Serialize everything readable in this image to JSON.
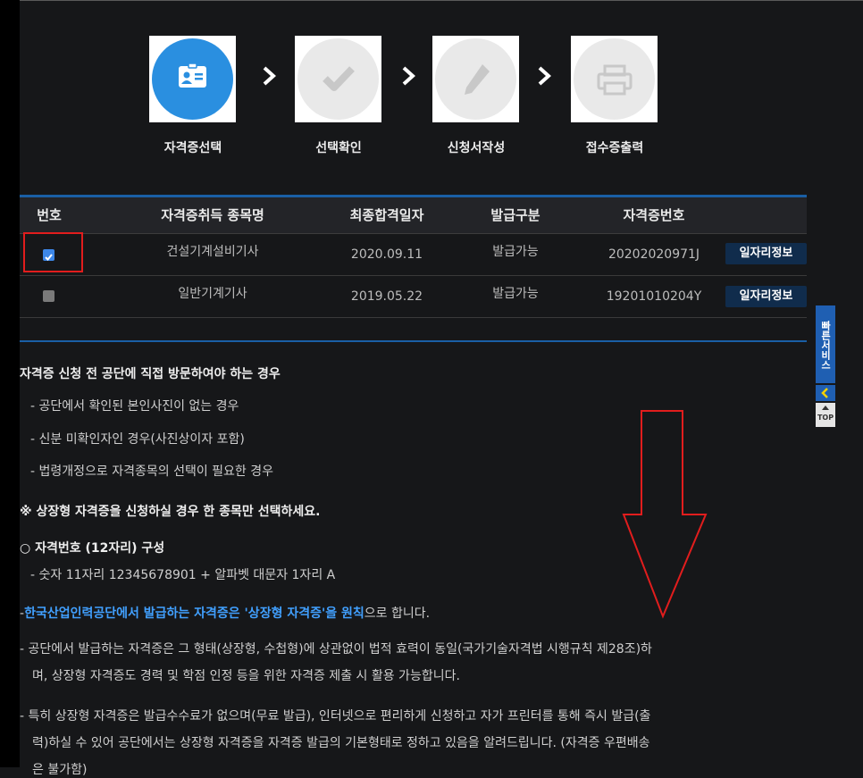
{
  "steps": [
    {
      "label": "자격증선택",
      "icon": "id-card-icon",
      "active": true
    },
    {
      "label": "선택확인",
      "icon": "checkmark-icon",
      "active": false
    },
    {
      "label": "신청서작성",
      "icon": "pencil-icon",
      "active": false
    },
    {
      "label": "접수증출력",
      "icon": "printer-icon",
      "active": false
    }
  ],
  "table": {
    "headers": [
      "번호",
      "자격증취득 종목명",
      "최종합격일자",
      "발급구분",
      "자격증번호"
    ],
    "rows": [
      {
        "checked": true,
        "name": "건설기계설비기사",
        "date": "2020.09.11",
        "status": "발급가능",
        "number": "20202020971J",
        "button": "일자리정보"
      },
      {
        "checked": false,
        "name": "일반기계기사",
        "date": "2019.05.22",
        "status": "발급가능",
        "number": "19201010204Y",
        "button": "일자리정보"
      }
    ]
  },
  "quick_service": {
    "label": "빠른서비스",
    "top": "TOP"
  },
  "notice": {
    "heading": "자격증 신청 전 공단에 직접 방문하여야 하는 경우",
    "items": [
      "- 공단에서 확인된 본인사진이 없는 경우",
      "- 신분 미확인자인 경우(사진상이자 포함)",
      "- 법령개정으로 자격종목의 선택이 필요한 경우"
    ],
    "warning": "※ 상장형 자격증을 신청하실 경우 한 종목만 선택하세요.",
    "cert_title": "○ 자격번호 (12자리) 구성",
    "cert_detail": "- 숫자 11자리 12345678901 + 알파벳 대문자 1자리 A",
    "principle_prefix": "-",
    "principle_highlight": "한국산업인력공단에서 발급하는 자격증은 '상장형 자격증'을 원칙",
    "principle_suffix": "으로 합니다.",
    "para1_line1": "- 공단에서 발급하는 자격증은 그 형태(상장형, 수첩형)에 상관없이 법적 효력이 동일(국가기술자격법 시행규칙 제28조)하",
    "para1_line2": "며, 상장형 자격증도 경력 및 학점 인정 등을 위한 자격증 제출 시 활용 가능합니다.",
    "para2_line1": "- 특히 상장형 자격증은 발급수수료가 없으며(무료 발급), 인터넷으로 편리하게 신청하고 자가 프린터를 통해 즉시 발급(출",
    "para2_line2": "력)하실 수 있어 공단에서는 상장형 자격증을 자격증 발급의 기본형태로 정하고 있음을 알려드립니다. (자격증 우편배송",
    "para2_line3": "은 불가함)"
  },
  "colors": {
    "accent": "#2a8fe0",
    "highlight_red": "#e11d1d",
    "link_blue": "#41a0ff",
    "button_bg": "#102c4c"
  }
}
